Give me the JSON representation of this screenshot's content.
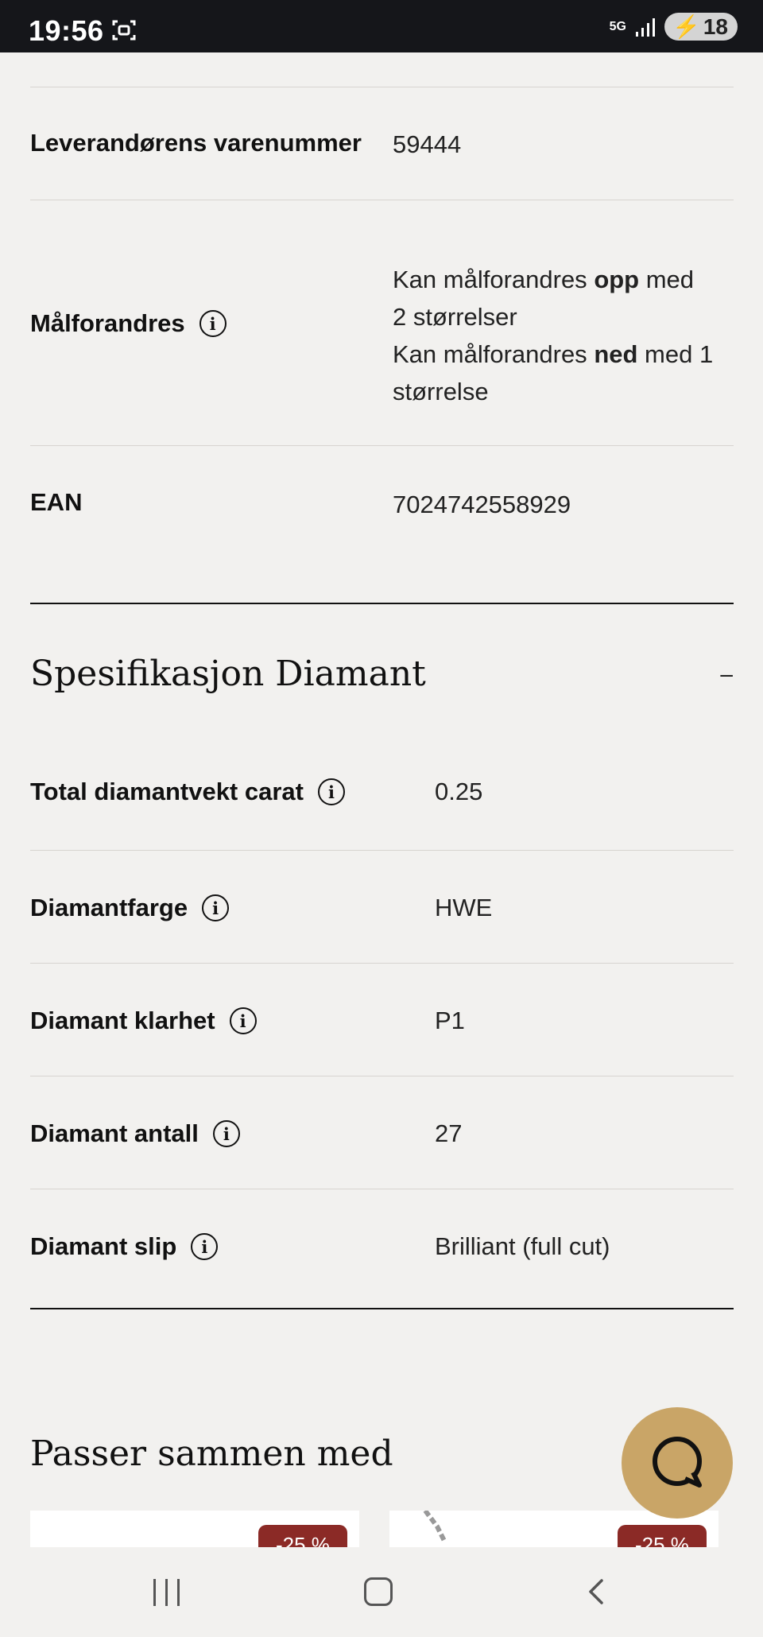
{
  "status_bar": {
    "time": "19:56",
    "network": "5G",
    "battery": "18"
  },
  "product_details": [
    {
      "label": "Leverandørens varenummer",
      "value": "59444"
    },
    {
      "label": "Målforandres",
      "value_lines": [
        "Kan målforandres opp med",
        "2 størrelser",
        "Kan målforandres ned med 1",
        "størrelse"
      ]
    },
    {
      "label": "EAN",
      "value": "7024742558929"
    }
  ],
  "diamond_section": {
    "title": "Spesifikasjon Diamant",
    "collapse_symbol": "–",
    "rows": [
      {
        "label": "Total diamantvekt carat",
        "value": "0.25"
      },
      {
        "label": "Diamantfarge",
        "value": "HWE"
      },
      {
        "label": "Diamant klarhet",
        "value": "P1"
      },
      {
        "label": "Diamant antall",
        "value": "27"
      },
      {
        "label": "Diamant slip",
        "value": "Brilliant (full cut)"
      }
    ]
  },
  "related": {
    "title": "Passer sammen med",
    "cards": [
      {
        "badge": "-25 %"
      },
      {
        "badge": "-25 %"
      }
    ]
  },
  "colors": {
    "accent_gold": "#c9a567",
    "badge_red": "#8b2a26",
    "background": "#f2f1ef"
  }
}
